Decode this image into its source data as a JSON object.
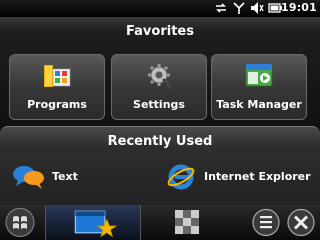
{
  "status_bar": {
    "icons": [
      "sync-icon",
      "signal-icon",
      "volume-off-icon",
      "battery-icon"
    ],
    "time": "19:01"
  },
  "favorites": {
    "title": "Favorites",
    "tiles": [
      {
        "label": "Programs",
        "icon": "programs-icon"
      },
      {
        "label": "Settings",
        "icon": "settings-icon"
      },
      {
        "label": "Task Manager",
        "icon": "task-manager-icon"
      }
    ]
  },
  "recently_used": {
    "title": "Recently Used",
    "items": [
      {
        "label": "Text",
        "icon": "text-messaging-icon"
      },
      {
        "label": "Internet Explorer",
        "icon": "internet-explorer-icon"
      }
    ]
  },
  "taskbar": {
    "buttons": [
      "windows-start-icon",
      "favorites-tab-icon",
      "apps-tab-icon",
      "menu-icon",
      "close-icon"
    ]
  },
  "colors": {
    "accent_blue": "#1e78d8",
    "star_yellow": "#f5b800",
    "ie_blue": "#2b84d6"
  }
}
